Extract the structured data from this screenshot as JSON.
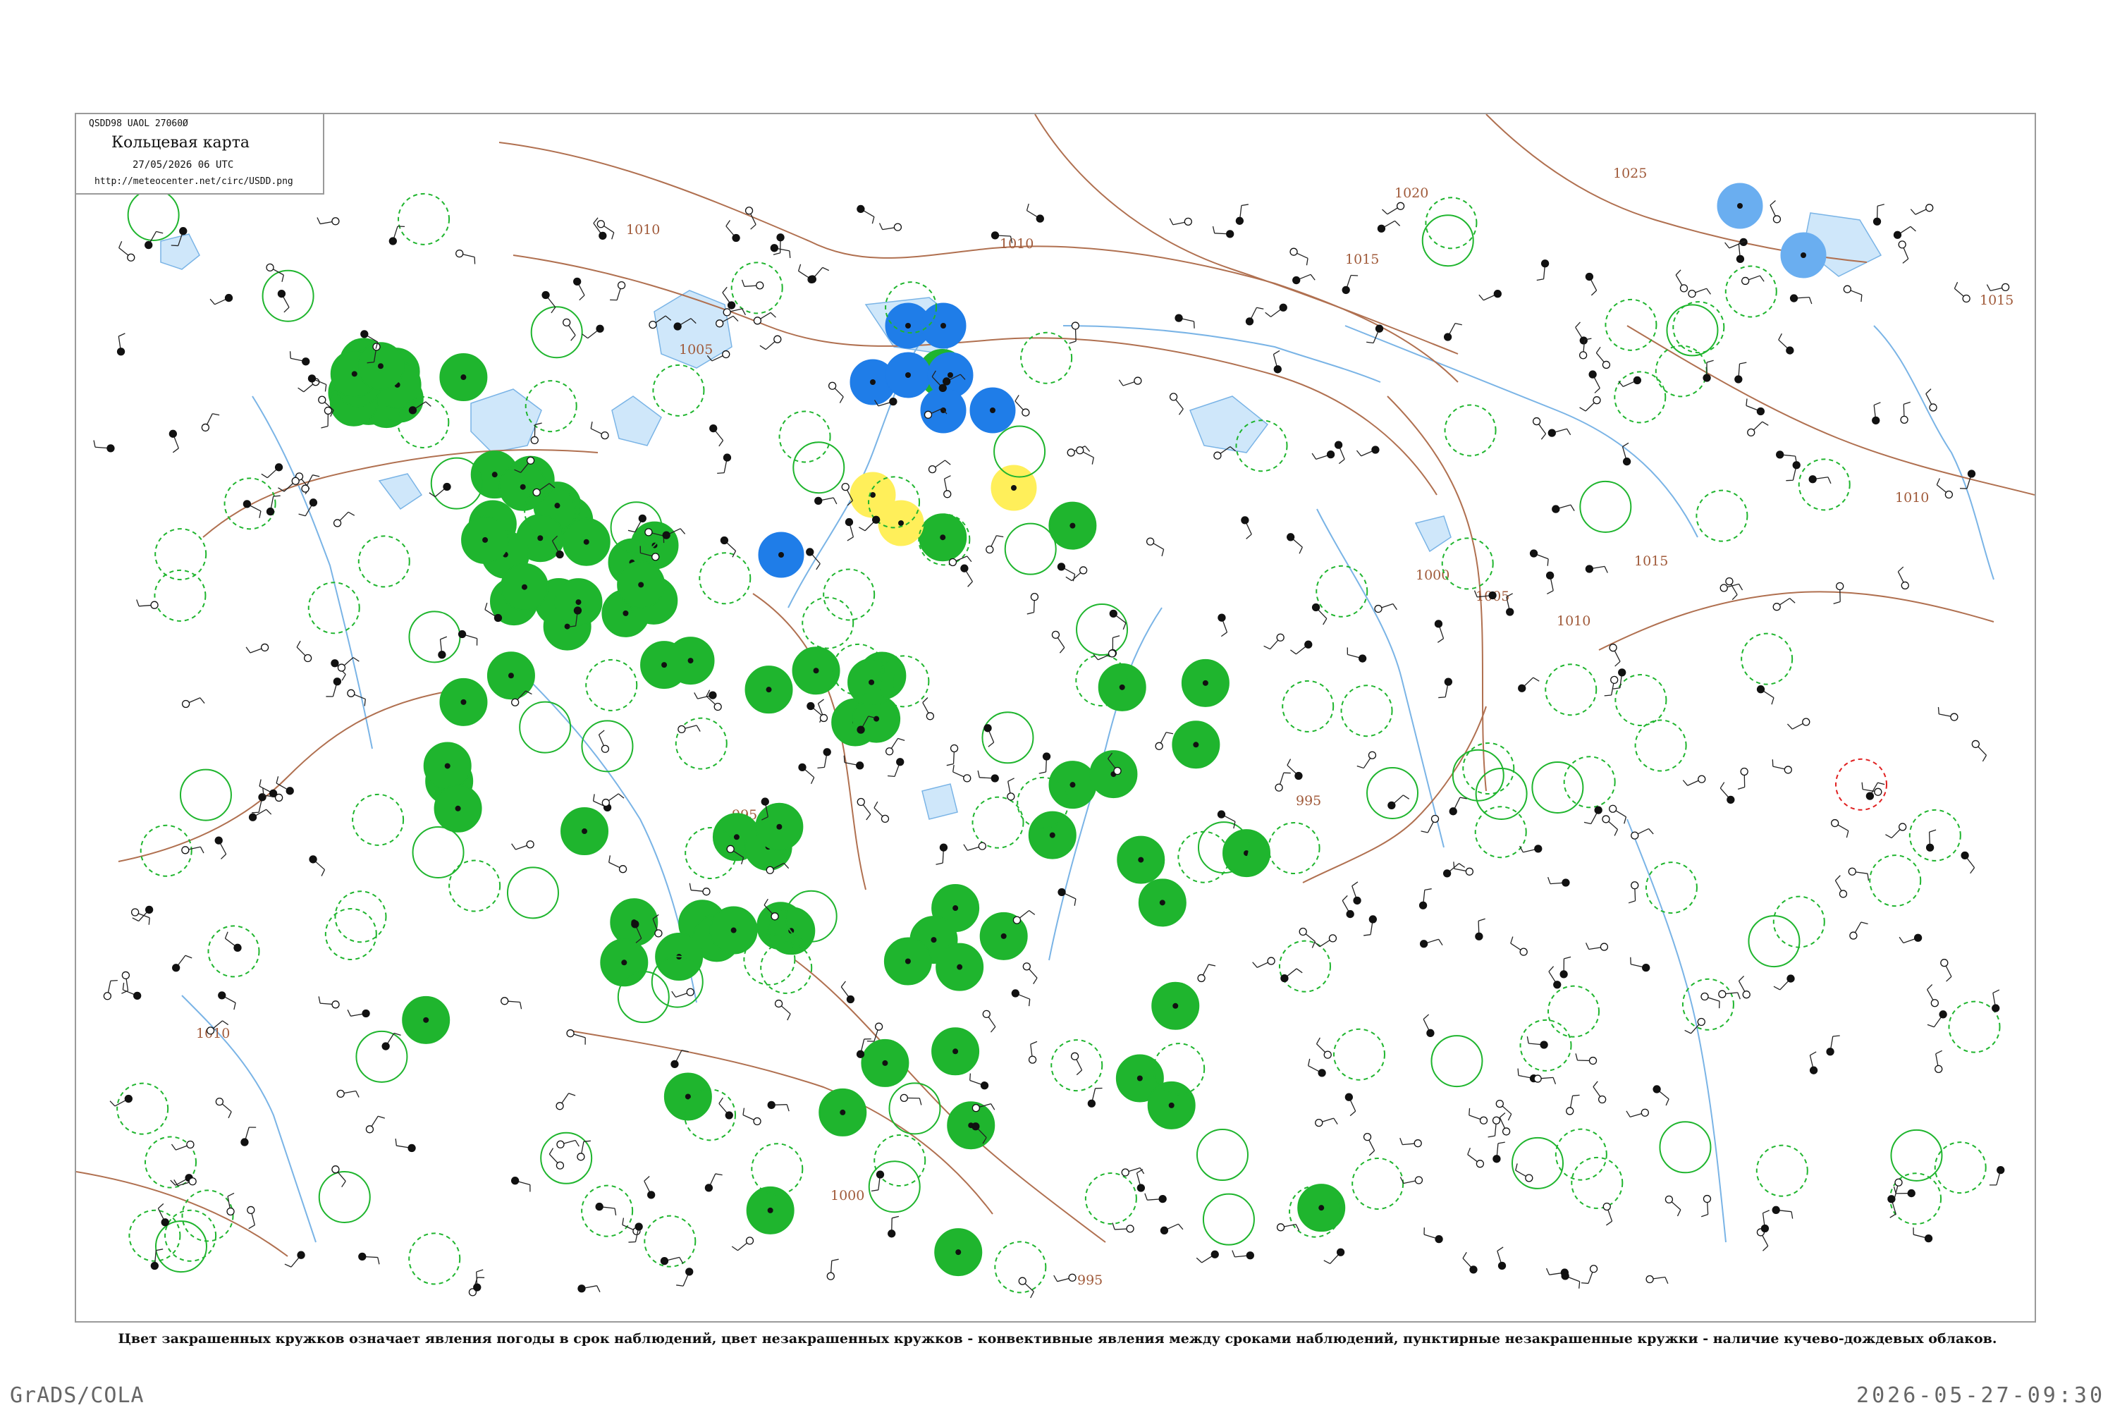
{
  "header": {
    "code_line": "QSDD98  UAOL  27060Ø",
    "title": "Кольцевая карта",
    "date": "27/05/2026 06 UTC",
    "url": "http://meteocenter.net/circ/USDD.png"
  },
  "caption": "Цвет закрашенных кружков означает явления погоды в срок наблюдений, цвет незакрашенных кружков - конвективные явления между сроками наблюдений, пунктирные незакрашенные кружки - наличие кучево-дождевых облаков.",
  "footer": {
    "left": "GrADS/COLA",
    "right": "2026-05-27-09:30"
  },
  "colors": {
    "isobar": "#a05a3a",
    "river": "#6aa8e0",
    "lake": "#bfe0f8",
    "filled_green": "#1fb52e",
    "filled_blue": "#1f7de8",
    "filled_lightblue": "#6aaef0",
    "filled_yellow": "#ffef5a",
    "ring_green": "#1fb52e",
    "ring_red": "#e02020"
  },
  "isobars": [
    {
      "value": "1020"
    },
    {
      "value": "1025"
    },
    {
      "value": "1015"
    },
    {
      "value": "1010"
    },
    {
      "value": "1005"
    },
    {
      "value": "1000"
    },
    {
      "value": "995"
    }
  ],
  "stations": {
    "filled_green": 95,
    "filled_blue": 8,
    "filled_lightblue": 2,
    "filled_yellow": 3,
    "solid_rings": 40,
    "dashed_rings": 90
  }
}
